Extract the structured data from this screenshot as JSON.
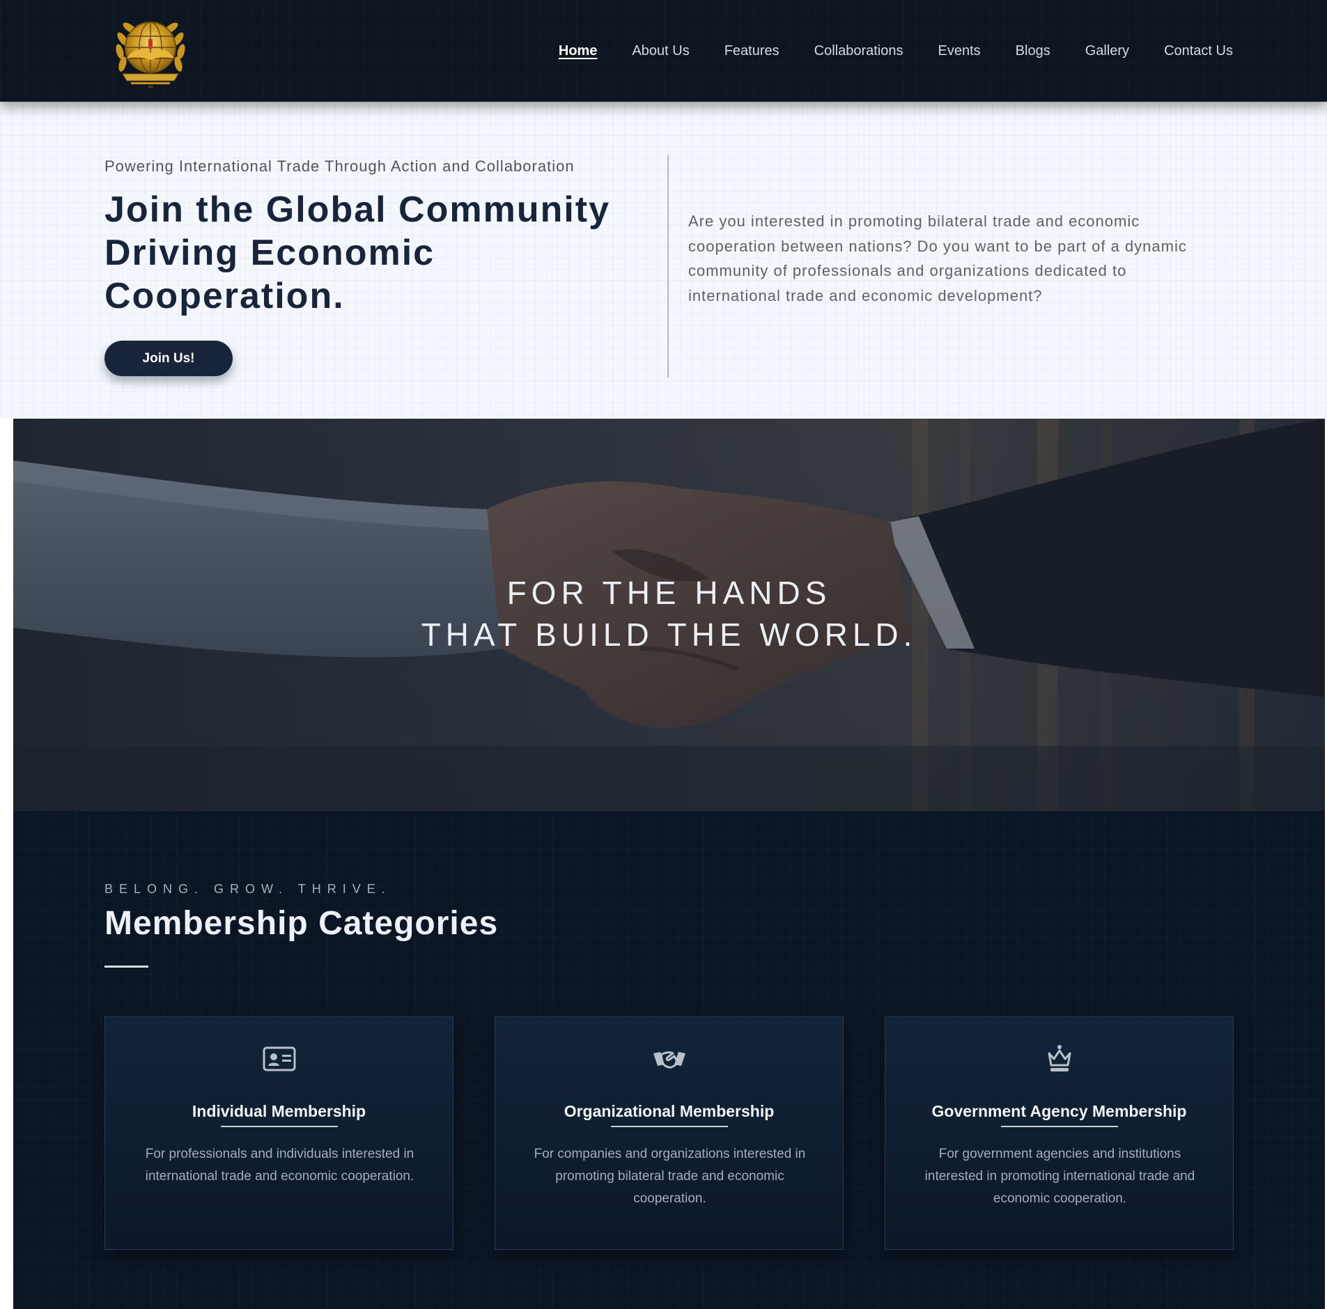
{
  "header": {
    "logo_alt": "International Trade emblem",
    "nav": [
      {
        "label": "Home",
        "active": true
      },
      {
        "label": "About Us"
      },
      {
        "label": "Features"
      },
      {
        "label": "Collaborations"
      },
      {
        "label": "Events"
      },
      {
        "label": "Blogs"
      },
      {
        "label": "Gallery"
      },
      {
        "label": "Contact Us"
      }
    ]
  },
  "intro": {
    "tagline": "Powering International Trade Through Action and Collaboration",
    "title": "Join the Global Community Driving Economic Cooperation.",
    "join_label": "Join Us!",
    "description": "Are you interested in promoting bilateral trade and economic cooperation between nations? Do you want to be part of a dynamic community of professionals and organizations dedicated to international trade and economic development?"
  },
  "hero": {
    "line1": "FOR THE HANDS",
    "line2": "THAT BUILD THE WORLD."
  },
  "membership": {
    "kicker": "BELONG. GROW. THRIVE.",
    "title": "Membership Categories",
    "cards": [
      {
        "icon": "id-card-icon",
        "title": "Individual Membership",
        "description": "For professionals and individuals interested in international trade and economic cooperation."
      },
      {
        "icon": "handshake-icon",
        "title": "Organizational Membership",
        "description": "For companies and organizations interested in promoting bilateral trade and economic cooperation."
      },
      {
        "icon": "crown-icon",
        "title": "Government Agency Membership",
        "description": "For government agencies and institutions interested in promoting international trade and economic cooperation."
      }
    ]
  },
  "colors": {
    "header_bg": "#0c1520",
    "navy": "#17243a",
    "gold": "#d4a631",
    "section_bg": "#0b1624"
  }
}
